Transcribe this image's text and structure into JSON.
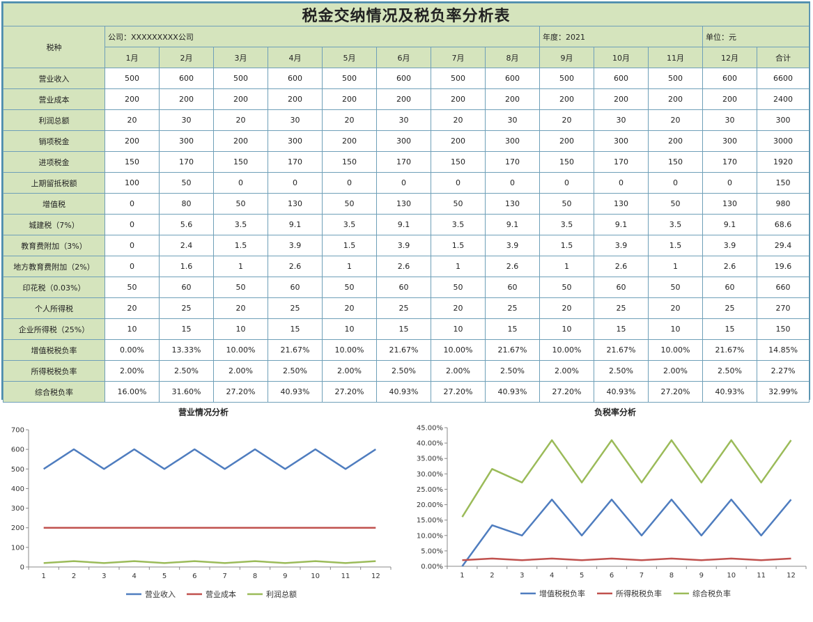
{
  "title": "税金交纳情况及税负率分析表",
  "header": {
    "tax_type_label": "税种",
    "company": "公司：XXXXXXXXX公司",
    "year": "年度：2021",
    "unit": "单位：元",
    "months": [
      "1月",
      "2月",
      "3月",
      "4月",
      "5月",
      "6月",
      "7月",
      "8月",
      "9月",
      "10月",
      "11月",
      "12月"
    ],
    "total_label": "合计"
  },
  "rows": [
    {
      "label": "营业收入",
      "cells": [
        "500",
        "600",
        "500",
        "600",
        "500",
        "600",
        "500",
        "600",
        "500",
        "600",
        "500",
        "600",
        "6600"
      ]
    },
    {
      "label": "营业成本",
      "cells": [
        "200",
        "200",
        "200",
        "200",
        "200",
        "200",
        "200",
        "200",
        "200",
        "200",
        "200",
        "200",
        "2400"
      ]
    },
    {
      "label": "利润总额",
      "cells": [
        "20",
        "30",
        "20",
        "30",
        "20",
        "30",
        "20",
        "30",
        "20",
        "30",
        "20",
        "30",
        "300"
      ]
    },
    {
      "label": "销项税金",
      "cells": [
        "200",
        "300",
        "200",
        "300",
        "200",
        "300",
        "200",
        "300",
        "200",
        "300",
        "200",
        "300",
        "3000"
      ]
    },
    {
      "label": "进项税金",
      "cells": [
        "150",
        "170",
        "150",
        "170",
        "150",
        "170",
        "150",
        "170",
        "150",
        "170",
        "150",
        "170",
        "1920"
      ]
    },
    {
      "label": "上期留抵税额",
      "cells": [
        "100",
        "50",
        "0",
        "0",
        "0",
        "0",
        "0",
        "0",
        "0",
        "0",
        "0",
        "0",
        "150"
      ]
    },
    {
      "label": "增值税",
      "cells": [
        "0",
        "80",
        "50",
        "130",
        "50",
        "130",
        "50",
        "130",
        "50",
        "130",
        "50",
        "130",
        "980"
      ]
    },
    {
      "label": "城建税（7%）",
      "cells": [
        "0",
        "5.6",
        "3.5",
        "9.1",
        "3.5",
        "9.1",
        "3.5",
        "9.1",
        "3.5",
        "9.1",
        "3.5",
        "9.1",
        "68.6"
      ]
    },
    {
      "label": "教育费附加（3%）",
      "cells": [
        "0",
        "2.4",
        "1.5",
        "3.9",
        "1.5",
        "3.9",
        "1.5",
        "3.9",
        "1.5",
        "3.9",
        "1.5",
        "3.9",
        "29.4"
      ]
    },
    {
      "label": "地方教育费附加（2%）",
      "cells": [
        "0",
        "1.6",
        "1",
        "2.6",
        "1",
        "2.6",
        "1",
        "2.6",
        "1",
        "2.6",
        "1",
        "2.6",
        "19.6"
      ]
    },
    {
      "label": "印花税（0.03%）",
      "cells": [
        "50",
        "60",
        "50",
        "60",
        "50",
        "60",
        "50",
        "60",
        "50",
        "60",
        "50",
        "60",
        "660"
      ]
    },
    {
      "label": "个人所得税",
      "cells": [
        "20",
        "25",
        "20",
        "25",
        "20",
        "25",
        "20",
        "25",
        "20",
        "25",
        "20",
        "25",
        "270"
      ]
    },
    {
      "label": "企业所得税（25%）",
      "cells": [
        "10",
        "15",
        "10",
        "15",
        "10",
        "15",
        "10",
        "15",
        "10",
        "15",
        "10",
        "15",
        "150"
      ]
    },
    {
      "label": "增值税税负率",
      "cells": [
        "0.00%",
        "13.33%",
        "10.00%",
        "21.67%",
        "10.00%",
        "21.67%",
        "10.00%",
        "21.67%",
        "10.00%",
        "21.67%",
        "10.00%",
        "21.67%",
        "14.85%"
      ]
    },
    {
      "label": "所得税税负率",
      "cells": [
        "2.00%",
        "2.50%",
        "2.00%",
        "2.50%",
        "2.00%",
        "2.50%",
        "2.00%",
        "2.50%",
        "2.00%",
        "2.50%",
        "2.00%",
        "2.50%",
        "2.27%"
      ]
    },
    {
      "label": "综合税负率",
      "cells": [
        "16.00%",
        "31.60%",
        "27.20%",
        "40.93%",
        "27.20%",
        "40.93%",
        "27.20%",
        "40.93%",
        "27.20%",
        "40.93%",
        "27.20%",
        "40.93%",
        "32.99%"
      ]
    }
  ],
  "chart_data": [
    {
      "type": "line",
      "title": "营业情况分析",
      "x": [
        1,
        2,
        3,
        4,
        5,
        6,
        7,
        8,
        9,
        10,
        11,
        12
      ],
      "ylim": [
        0,
        700
      ],
      "yticks": [
        0,
        100,
        200,
        300,
        400,
        500,
        600,
        700
      ],
      "ytick_labels": [
        "0",
        "100",
        "200",
        "300",
        "400",
        "500",
        "600",
        "700"
      ],
      "legend_position": "bottom",
      "series": [
        {
          "name": "营业收入",
          "color": "#4f7dbf",
          "values": [
            500,
            600,
            500,
            600,
            500,
            600,
            500,
            600,
            500,
            600,
            500,
            600
          ]
        },
        {
          "name": "营业成本",
          "color": "#c0504d",
          "values": [
            200,
            200,
            200,
            200,
            200,
            200,
            200,
            200,
            200,
            200,
            200,
            200
          ]
        },
        {
          "name": "利润总额",
          "color": "#9bbb59",
          "values": [
            20,
            30,
            20,
            30,
            20,
            30,
            20,
            30,
            20,
            30,
            20,
            30
          ]
        }
      ]
    },
    {
      "type": "line",
      "title": "负税率分析",
      "x": [
        1,
        2,
        3,
        4,
        5,
        6,
        7,
        8,
        9,
        10,
        11,
        12
      ],
      "ylim": [
        0,
        0.45
      ],
      "yticks": [
        0,
        0.05,
        0.1,
        0.15,
        0.2,
        0.25,
        0.3,
        0.35,
        0.4,
        0.45
      ],
      "ytick_labels": [
        "0.00%",
        "5.00%",
        "10.00%",
        "15.00%",
        "20.00%",
        "25.00%",
        "30.00%",
        "35.00%",
        "40.00%",
        "45.00%"
      ],
      "legend_position": "bottom",
      "series": [
        {
          "name": "增值税税负率",
          "color": "#4f7dbf",
          "values": [
            0,
            0.1333,
            0.1,
            0.2167,
            0.1,
            0.2167,
            0.1,
            0.2167,
            0.1,
            0.2167,
            0.1,
            0.2167
          ]
        },
        {
          "name": "所得税税负率",
          "color": "#c0504d",
          "values": [
            0.02,
            0.025,
            0.02,
            0.025,
            0.02,
            0.025,
            0.02,
            0.025,
            0.02,
            0.025,
            0.02,
            0.025
          ]
        },
        {
          "name": "综合税负率",
          "color": "#9bbb59",
          "values": [
            0.16,
            0.316,
            0.272,
            0.4093,
            0.272,
            0.4093,
            0.272,
            0.4093,
            0.272,
            0.4093,
            0.272,
            0.4093
          ]
        }
      ]
    }
  ]
}
